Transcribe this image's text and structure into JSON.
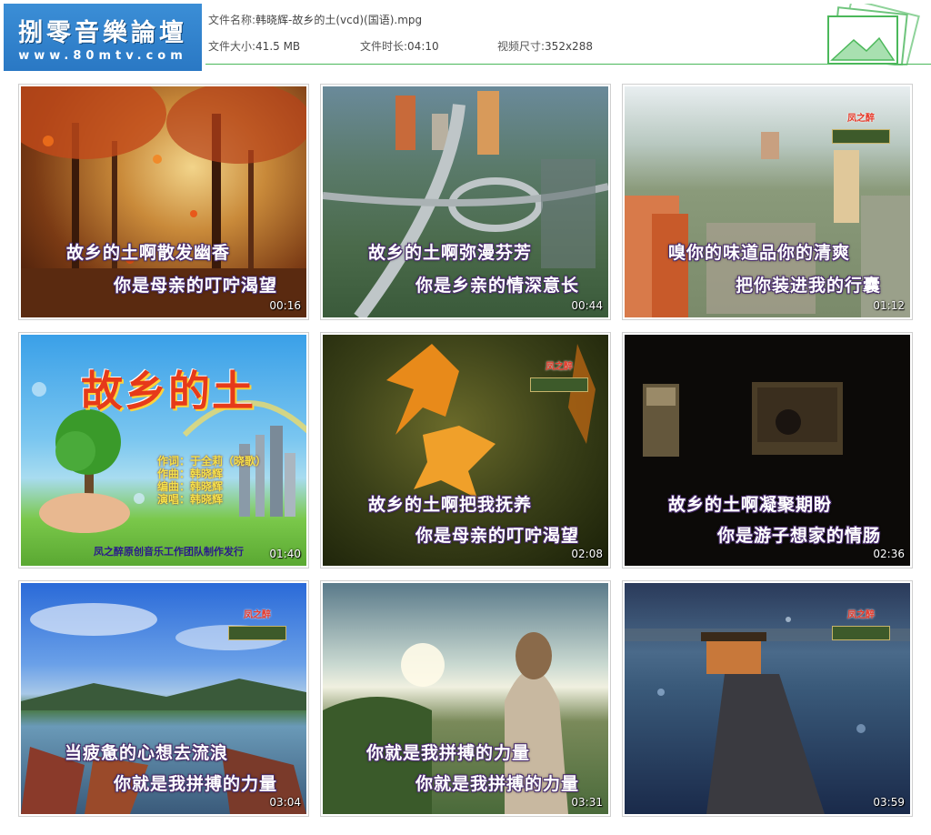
{
  "logo": {
    "title": "捌零音樂論壇",
    "url": "www.80mtv.com"
  },
  "file_info": {
    "name_label": "文件名称:",
    "name_value": "韩晓辉-故乡的土(vcd)(国语).mpg",
    "size_label": "文件大小:",
    "size_value": "41.5 MB",
    "duration_label": "文件时长:",
    "duration_value": "04:10",
    "dimensions_label": "视频尺寸:",
    "dimensions_value": "352x288"
  },
  "studio_logo": "凤之醉",
  "thumbnails": [
    {
      "line1": "故乡的土啊散发幽香",
      "line2": "你是母亲的叮咛渴望",
      "time": "00:16"
    },
    {
      "line1": "故乡的土啊弥漫芬芳",
      "line2": "你是乡亲的情深意长",
      "time": "00:44"
    },
    {
      "line1": "嗅你的味道品你的清爽",
      "line2": "把你装进我的行囊",
      "time": "01:12"
    },
    {
      "title": "故乡的土",
      "credits": [
        "作词：于全莉（晓歌）",
        "作曲：韩晓辉",
        "编曲：韩晓辉",
        "演唱：韩晓辉"
      ],
      "footer": "凤之醉原创音乐工作团队制作发行",
      "time": "01:40"
    },
    {
      "line1": "故乡的土啊把我抚养",
      "line2": "你是母亲的叮咛渴望",
      "time": "02:08"
    },
    {
      "line1": "故乡的土啊凝聚期盼",
      "line2": "你是游子想家的情肠",
      "time": "02:36"
    },
    {
      "line1": "当疲惫的心想去流浪",
      "line2": "你就是我拼搏的力量",
      "time": "03:04"
    },
    {
      "line1": "你就是我拼搏的力量",
      "line2": "你就是我拼搏的力量",
      "time": "03:31"
    },
    {
      "time": "03:59"
    }
  ],
  "colors": {
    "logo_bg": "#2f82cc",
    "header_rule": "#4bb85a",
    "lyric_outline": "#4a2d6e"
  }
}
